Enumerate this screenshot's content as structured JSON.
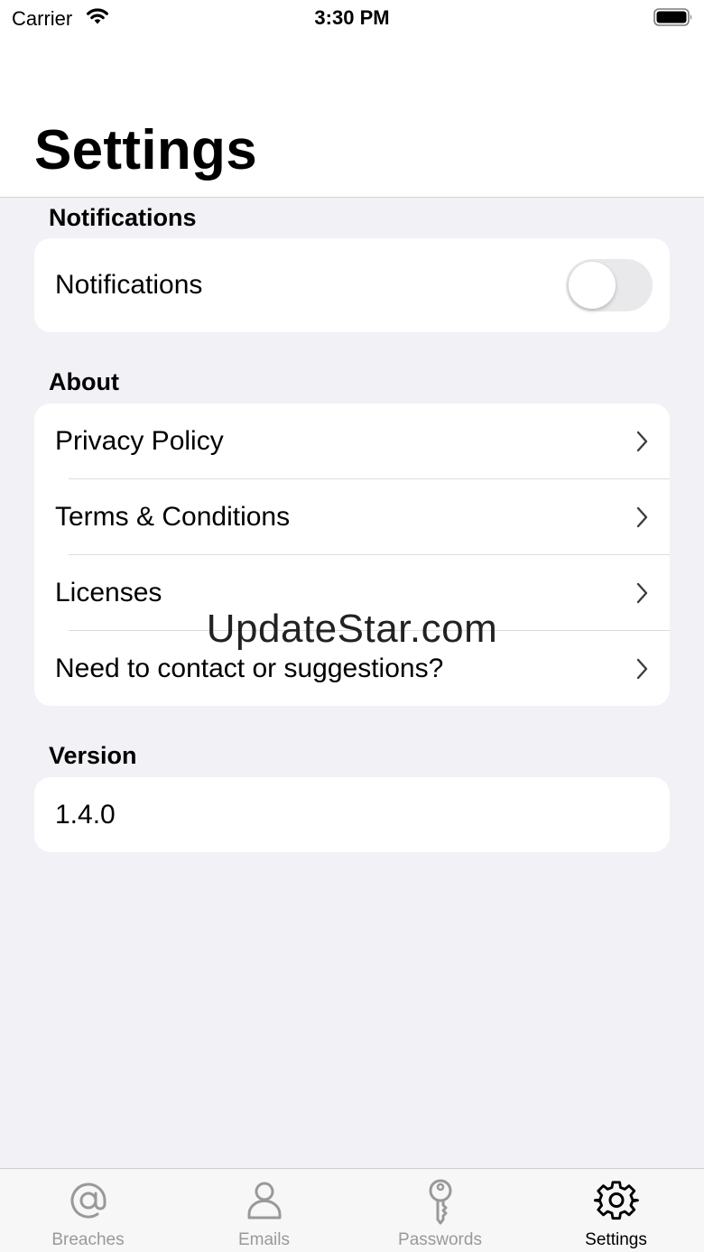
{
  "status_bar": {
    "carrier": "Carrier",
    "time": "3:30 PM"
  },
  "title": "Settings",
  "sections": {
    "notifications": {
      "header": "Notifications",
      "row_label": "Notifications",
      "toggle_on": false
    },
    "about": {
      "header": "About",
      "items": [
        {
          "label": "Privacy Policy"
        },
        {
          "label": "Terms & Conditions"
        },
        {
          "label": "Licenses"
        },
        {
          "label": "Need to contact or suggestions?"
        }
      ]
    },
    "version": {
      "header": "Version",
      "value": "1.4.0"
    }
  },
  "watermark": "UpdateStar.com",
  "tabs": [
    {
      "label": "Breaches",
      "icon": "at-icon",
      "active": false
    },
    {
      "label": "Emails",
      "icon": "person-icon",
      "active": false
    },
    {
      "label": "Passwords",
      "icon": "key-icon",
      "active": false
    },
    {
      "label": "Settings",
      "icon": "gear-icon",
      "active": true
    }
  ],
  "colors": {
    "inactive": "#999999",
    "active": "#000000",
    "background": "#f1f1f6"
  }
}
